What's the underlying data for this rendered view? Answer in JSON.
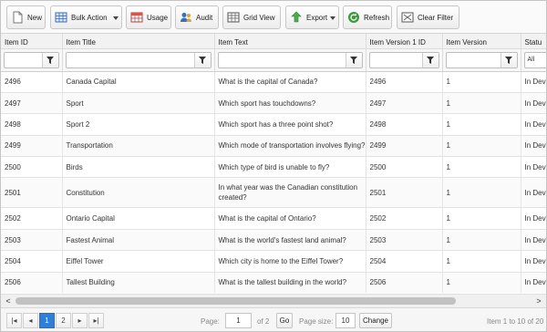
{
  "toolbar": {
    "new_label": "New",
    "bulk_action_label": "Bulk Action",
    "usage_label": "Usage",
    "audit_label": "Audit",
    "grid_view_label": "Grid View",
    "export_label": "Export",
    "refresh_label": "Refresh",
    "clear_filter_label": "Clear Filter"
  },
  "columns": [
    "Item ID",
    "Item Title",
    "Item Text",
    "Item Version 1 ID",
    "Item Version",
    "Statu"
  ],
  "filters": {
    "item_id": "",
    "item_title": "",
    "item_text": "",
    "item_version_1_id": "",
    "item_version": "",
    "status_selected": "All"
  },
  "rows": [
    {
      "id": "2496",
      "title": "Canada Capital",
      "text": "What is the capital of Canada?",
      "v1id": "2496",
      "version": "1",
      "status": "In Deve"
    },
    {
      "id": "2497",
      "title": "Sport",
      "text": "Which sport has touchdowns?",
      "v1id": "2497",
      "version": "1",
      "status": "In Deve"
    },
    {
      "id": "2498",
      "title": "Sport 2",
      "text": "Which sport has a three point shot?",
      "v1id": "2498",
      "version": "1",
      "status": "In Deve"
    },
    {
      "id": "2499",
      "title": "Transportation",
      "text": "Which mode of transportation involves flying?",
      "v1id": "2499",
      "version": "1",
      "status": "In Deve"
    },
    {
      "id": "2500",
      "title": "Birds",
      "text": "Which type of bird is unable to fly?",
      "v1id": "2500",
      "version": "1",
      "status": "In Deve"
    },
    {
      "id": "2501",
      "title": "Constitution",
      "text": "In what year was the Canadian constitution created?",
      "v1id": "2501",
      "version": "1",
      "status": "In Deve"
    },
    {
      "id": "2502",
      "title": "Ontario Capital",
      "text": "What is the capital of Ontario?",
      "v1id": "2502",
      "version": "1",
      "status": "In Deve"
    },
    {
      "id": "2503",
      "title": "Fastest Animal",
      "text": "What is the world's fastest land animal?",
      "v1id": "2503",
      "version": "1",
      "status": "In Deve"
    },
    {
      "id": "2504",
      "title": "Eiffel Tower",
      "text": "Which city is home to the Eiffel Tower?",
      "v1id": "2504",
      "version": "1",
      "status": "In Deve"
    },
    {
      "id": "2506",
      "title": "Tallest Building",
      "text": "What is the tallest building in the world?",
      "v1id": "2506",
      "version": "1",
      "status": "In Deve"
    }
  ],
  "scrollbar": {
    "left_arrow": "<",
    "right_arrow": ">"
  },
  "pager": {
    "first": "|◂",
    "prev": "◂",
    "pages": [
      "1",
      "2"
    ],
    "current_page": "1",
    "next": "▸",
    "last": "▸|",
    "page_label": "Page:",
    "page_value": "1",
    "of_label": "of 2",
    "go_label": "Go",
    "page_size_label": "Page size:",
    "page_size_value": "10",
    "change_label": "Change",
    "summary": "Item 1 to 10 of 20"
  },
  "colors": {
    "accent": "#2f7ed8",
    "toolbar_bg": "#fafafa",
    "header_bg": "#f2f2f2"
  },
  "icons": [
    "new-document-icon",
    "bulk-action-grid-icon",
    "usage-table-icon",
    "audit-users-icon",
    "grid-view-icon",
    "export-arrow-icon",
    "refresh-icon",
    "clear-filter-icon",
    "filter-funnel-icon"
  ]
}
